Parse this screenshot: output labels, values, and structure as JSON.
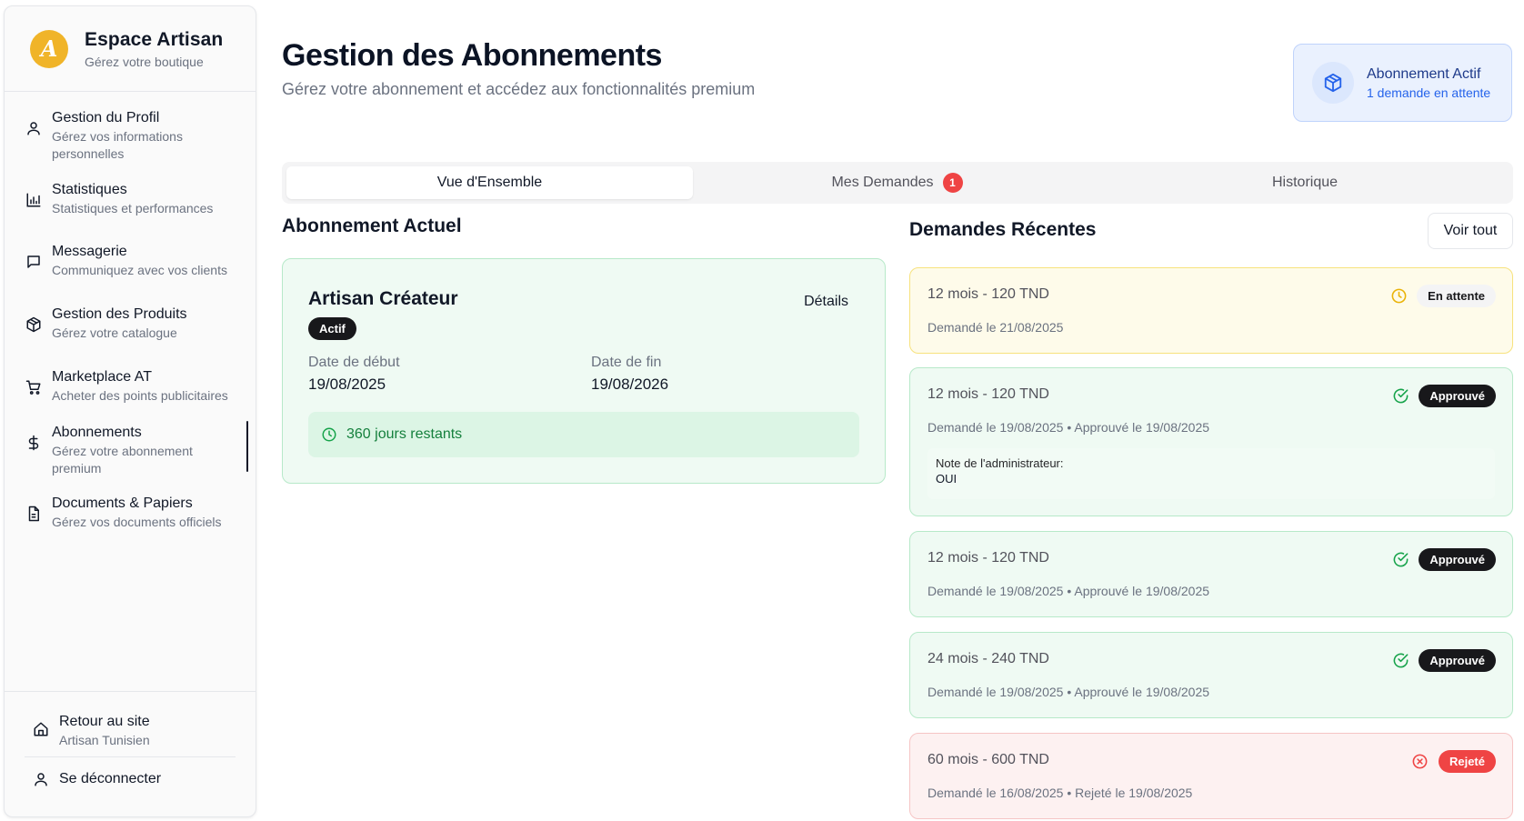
{
  "brand": {
    "logo_letter": "A",
    "title": "Espace Artisan",
    "subtitle": "Gérez votre boutique"
  },
  "sidebar": {
    "items": [
      {
        "label": "Gestion du Profil",
        "sub": "Gérez vos informations personnelles",
        "icon": "user-icon"
      },
      {
        "label": "Statistiques",
        "sub": "Statistiques et performances",
        "icon": "bar-chart-icon"
      },
      {
        "label": "Messagerie",
        "sub": "Communiquez avec vos clients",
        "icon": "message-icon"
      },
      {
        "label": "Gestion des Produits",
        "sub": "Gérez votre catalogue",
        "icon": "package-icon"
      },
      {
        "label": "Marketplace AT",
        "sub": "Acheter des points publicitaires",
        "icon": "cart-icon"
      },
      {
        "label": "Abonnements",
        "sub": "Gérez votre abonnement premium",
        "icon": "dollar-icon",
        "active": true
      },
      {
        "label": "Documents & Papiers",
        "sub": "Gérez vos documents officiels",
        "icon": "document-icon"
      }
    ],
    "footer": {
      "back_label": "Retour au site",
      "back_sub": "Artisan Tunisien",
      "logout_label": "Se déconnecter"
    }
  },
  "header": {
    "title": "Gestion des Abonnements",
    "subtitle": "Gérez votre abonnement et accédez aux fonctionnalités premium"
  },
  "status_card": {
    "title": "Abonnement Actif",
    "subtitle": "1 demande en attente",
    "icon": "cube-icon"
  },
  "tabs": [
    {
      "label": "Vue d'Ensemble",
      "active": true
    },
    {
      "label": "Mes Demandes",
      "badge": "1"
    },
    {
      "label": "Historique"
    }
  ],
  "current": {
    "heading": "Abonnement Actuel",
    "plan": "Artisan Créateur",
    "badge": "Actif",
    "details_label": "Détails",
    "start_label": "Date de début",
    "start_value": "19/08/2025",
    "end_label": "Date de fin",
    "end_value": "19/08/2026",
    "remaining": "360 jours restants"
  },
  "requests": {
    "heading": "Demandes Récentes",
    "see_all": "Voir tout",
    "note_label": "Note de l'administrateur:",
    "items": [
      {
        "title": "12 mois - 120 TND",
        "meta": "Demandé le 21/08/2025",
        "status": "En attente",
        "kind": "pending"
      },
      {
        "title": "12 mois - 120 TND",
        "meta": "Demandé le 19/08/2025 • Approuvé le 19/08/2025",
        "status": "Approuvé",
        "kind": "approved",
        "note": "OUI"
      },
      {
        "title": "12 mois - 120 TND",
        "meta": "Demandé le 19/08/2025 • Approuvé le 19/08/2025",
        "status": "Approuvé",
        "kind": "approved"
      },
      {
        "title": "24 mois - 240 TND",
        "meta": "Demandé le 19/08/2025 • Approuvé le 19/08/2025",
        "status": "Approuvé",
        "kind": "approved"
      },
      {
        "title": "60 mois - 600 TND",
        "meta": "Demandé le 16/08/2025 • Rejeté le 19/08/2025",
        "status": "Rejeté",
        "kind": "rejected"
      }
    ]
  },
  "colors": {
    "accent": "#2563eb",
    "success": "#16a34a",
    "warning": "#eab308",
    "danger": "#ef4444",
    "logo": "#f0b429"
  }
}
